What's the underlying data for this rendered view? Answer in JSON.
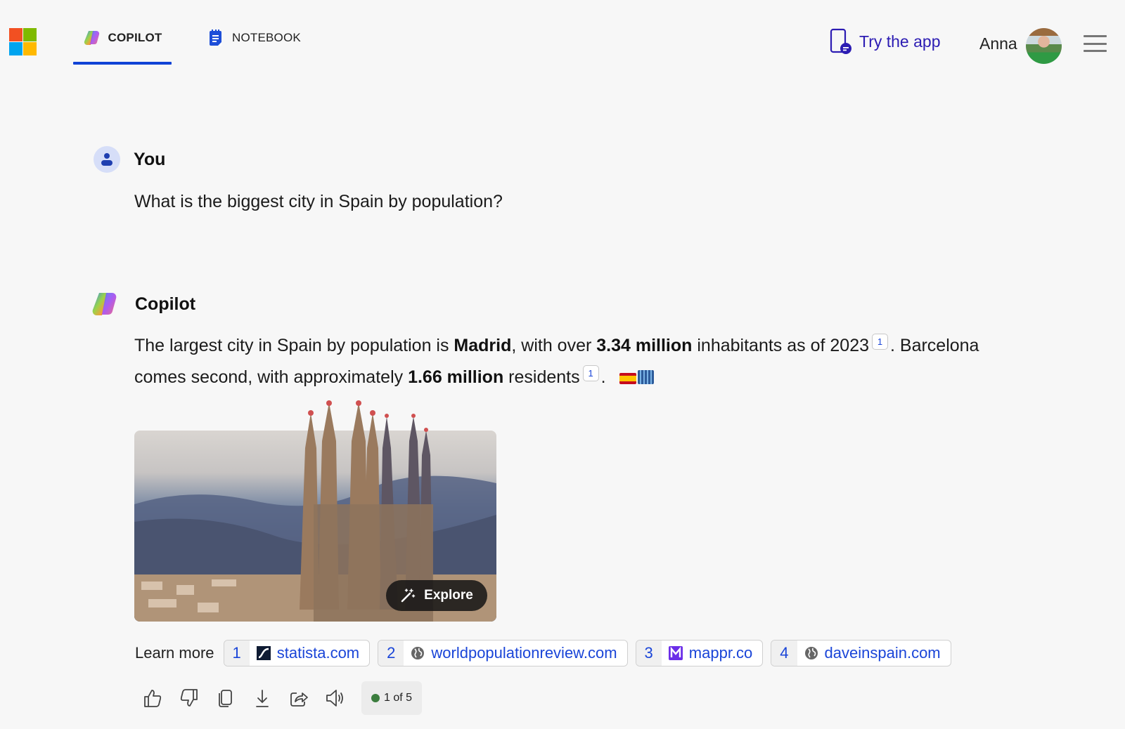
{
  "header": {
    "tabs": [
      {
        "label": "COPILOT",
        "icon": "copilot-logo-icon",
        "active": true
      },
      {
        "label": "NOTEBOOK",
        "icon": "notebook-icon",
        "active": false
      }
    ],
    "try_app_label": "Try the app",
    "user_name": "Anna",
    "accent_color": "#1043d6"
  },
  "conversation": {
    "user": {
      "name": "You",
      "message": "What is the biggest city in Spain by population?"
    },
    "assistant": {
      "name": "Copilot",
      "answer": {
        "p1": "The largest city in Spain by population is ",
        "b1": "Madrid",
        "p2": ", with over ",
        "b2": "3.34 million",
        "p3": " inhabitants as of 2023",
        "cite1": "1",
        "p4": ". Barcelona comes second, with approximately ",
        "b3": "1.66 million",
        "p5": " residents",
        "cite2": "1",
        "p6": ". "
      },
      "image": {
        "subject": "Sagrada Familia, Barcelona",
        "explore_label": "Explore"
      },
      "learn_more": {
        "label": "Learn more",
        "sources": [
          {
            "num": "1",
            "site": "statista.com",
            "icon": "statista-icon"
          },
          {
            "num": "2",
            "site": "worldpopulationreview.com",
            "icon": "globe-icon"
          },
          {
            "num": "3",
            "site": "mappr.co",
            "icon": "mappr-icon"
          },
          {
            "num": "4",
            "site": "daveinspain.com",
            "icon": "globe-icon"
          }
        ]
      },
      "actions": [
        "like",
        "dislike",
        "copy",
        "export",
        "share",
        "read-aloud"
      ],
      "page_indicator": "1 of 5"
    }
  }
}
